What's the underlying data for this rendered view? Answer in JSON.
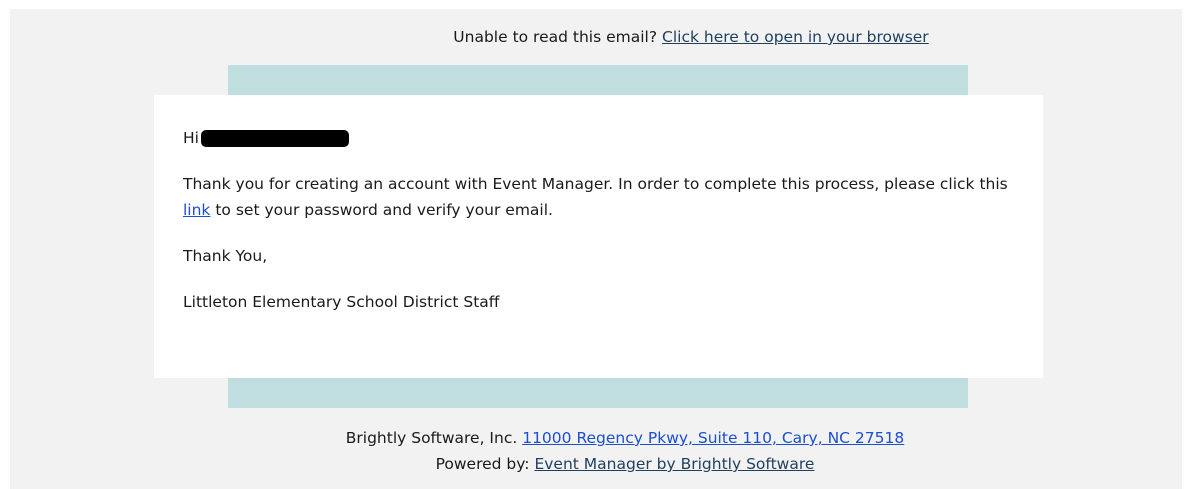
{
  "header": {
    "prompt_text": "Unable to read this email?",
    "browser_link": "Click here to open in your browser"
  },
  "message": {
    "greeting": "Hi",
    "body_before_link": "Thank you for creating an account with Event Manager. In order to complete this process, please click this",
    "link_text": "link",
    "body_after_link": "to set your password and verify your email.",
    "signoff": "Thank You,",
    "signature": "Littleton Elementary School District Staff"
  },
  "footer": {
    "company": "Brightly Software, Inc.",
    "address_link": "11000 Regency Pkwy, Suite 110, Cary, NC 27518",
    "powered_label": "Powered by:",
    "powered_link": "Event Manager by Brightly Software"
  },
  "colors": {
    "background": "#f2f2f2",
    "band": "#c0dde0",
    "card": "#ffffff",
    "link": "#1a4fd0"
  }
}
